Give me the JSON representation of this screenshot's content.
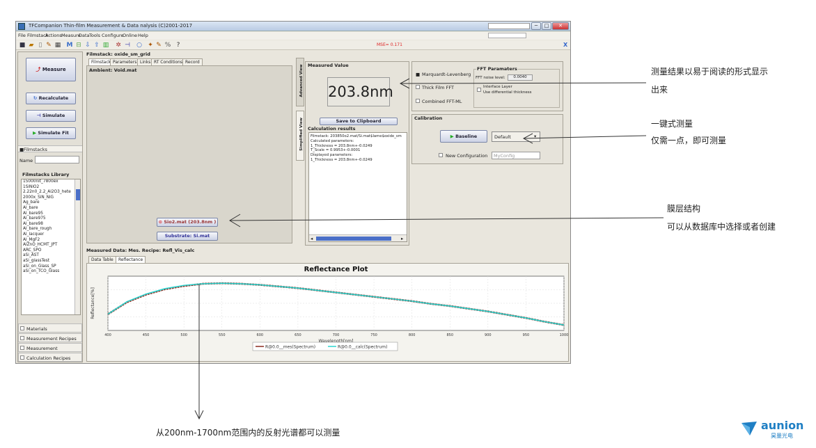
{
  "window": {
    "title": "TFCompanion Thin-film Measurement & Data nalysis (C)2001-2017",
    "close": "✕",
    "min": "─",
    "max": "□"
  },
  "menu": [
    "File",
    "Filmstack",
    "Actions",
    "Measure",
    "Data",
    "Tools",
    "Configure",
    "Online",
    "Help"
  ],
  "toolbar": {
    "mse": "MSE= 0.171",
    "pin": "X"
  },
  "left": {
    "measure": "Measure",
    "recalculate": "Recalculate",
    "simulate": "Simulate",
    "simulate_fit": "Simulate Fit",
    "filmstacks_header": "Filmstacks",
    "name_label": "Name",
    "library_title": "Filmstacks Library",
    "library_items": [
      "15000nit_7800ex",
      "1SiNiO2",
      "2.22n0_2.2_Al2O3_hete",
      "2000x_SiN_NiG",
      "Ag_bare",
      "Al_bare",
      "Al_bare95",
      "Al_bare975",
      "Al_bare98",
      "Al_bare_rough",
      "Al_lacquer",
      "Al_MgF2",
      "AlZnO_HCMT_JPT",
      "ARC_SPO",
      "aSi_AST",
      "aSi_glassTest",
      "aSi_on_Glass_SP",
      "aSi_on_TCO_Glass"
    ],
    "bottom_tabs": [
      "Materials",
      "Measurement Recipes",
      "Measurement",
      "Calculation Recipes"
    ]
  },
  "filmstack": {
    "title": "Filmstack: oxide_sm_grid",
    "tabs": [
      "Filmstack",
      "Parameters",
      "Links",
      "RT Conditions",
      "Record"
    ],
    "ambient": "Ambient: Void.mat",
    "layer": "Sio2.mat (203.8nm )",
    "substrate": "Substrate: Si.mat"
  },
  "side_tabs": {
    "advanced": "Advanced View",
    "simplified": "Simplified View"
  },
  "measured": {
    "title": "Measured Value",
    "value": "203.8nm",
    "save": "Save to Clipboard",
    "calc_title": "Calculation results",
    "calc_lines": [
      "Filmstack: 203850o2.mat/Si.mat$lame$oxide_sm",
      "Calculated parameters:",
      "1_Thickness = 203.8nm+-0.0249",
      "T_Scale = 0.9953+-0.0001",
      "Displayed parameters:",
      "1_Thickness = 203.8nm+-0.0249"
    ]
  },
  "fit": {
    "marquardt": "Marquardt-Levenberg",
    "thick_fft": "Thick Film FFT",
    "combined": "Combined FFT-ML",
    "fft_title": "FFT Paramaters",
    "fft_noise_label": "FFT noise level:",
    "fft_noise": "0.0040",
    "interface": "Interface Layer",
    "differential": "Use differential thickness"
  },
  "calibration": {
    "title": "Calibration",
    "baseline": "Baseline",
    "dropdown": "Default",
    "new_config": "New Configuration",
    "config_name": "MyConfig"
  },
  "measured_data": {
    "title": "Measured Data: Mes. Recipe: Refl_Vis_calc",
    "tabs": [
      "Data Table",
      "Reflectance"
    ]
  },
  "chart_data": {
    "type": "line",
    "title": "Reflectance Plot",
    "xlabel": "Wavelength[nm]",
    "ylabel": "Reflectance[%]",
    "xlim": [
      400,
      1000
    ],
    "xticks": [
      "400",
      "450",
      "500",
      "550",
      "600",
      "650",
      "700",
      "750",
      "800",
      "850",
      "900",
      "950",
      "1000"
    ],
    "x": [
      400,
      425,
      450,
      475,
      500,
      525,
      550,
      575,
      600,
      625,
      650,
      675,
      700,
      725,
      750,
      775,
      800,
      825,
      850,
      875,
      900,
      925,
      950,
      975,
      1000
    ],
    "series": [
      {
        "name": "R@0.0__mes(Spectrum)",
        "color": "#8b2b1f",
        "values": [
          0.3,
          0.52,
          0.66,
          0.76,
          0.82,
          0.86,
          0.87,
          0.86,
          0.84,
          0.81,
          0.78,
          0.74,
          0.7,
          0.66,
          0.62,
          0.58,
          0.54,
          0.49,
          0.45,
          0.4,
          0.35,
          0.29,
          0.23,
          0.16,
          0.1
        ]
      },
      {
        "name": "R@0.0__calc(Spectrum)",
        "color": "#2ad5d0",
        "values": [
          0.3,
          0.53,
          0.67,
          0.77,
          0.83,
          0.86,
          0.87,
          0.86,
          0.84,
          0.81,
          0.78,
          0.74,
          0.7,
          0.66,
          0.62,
          0.58,
          0.54,
          0.49,
          0.45,
          0.4,
          0.35,
          0.29,
          0.23,
          0.16,
          0.1
        ]
      }
    ]
  },
  "annotations": {
    "a1_line1": "测量结果以易于阅读的形式显示",
    "a1_line2": "出来",
    "a2_line1": "一键式测量",
    "a2_line2": "仅需一点，即可测量",
    "a3_line1": "膜层结构",
    "a3_line2": "可以从数据库中选择或者创建",
    "a4": "从200nm-1700nm范围内的反射光谱都可以测量"
  },
  "logo": {
    "name": "aunion",
    "sub": "昊量光电",
    "color": "#1f7fc4"
  }
}
